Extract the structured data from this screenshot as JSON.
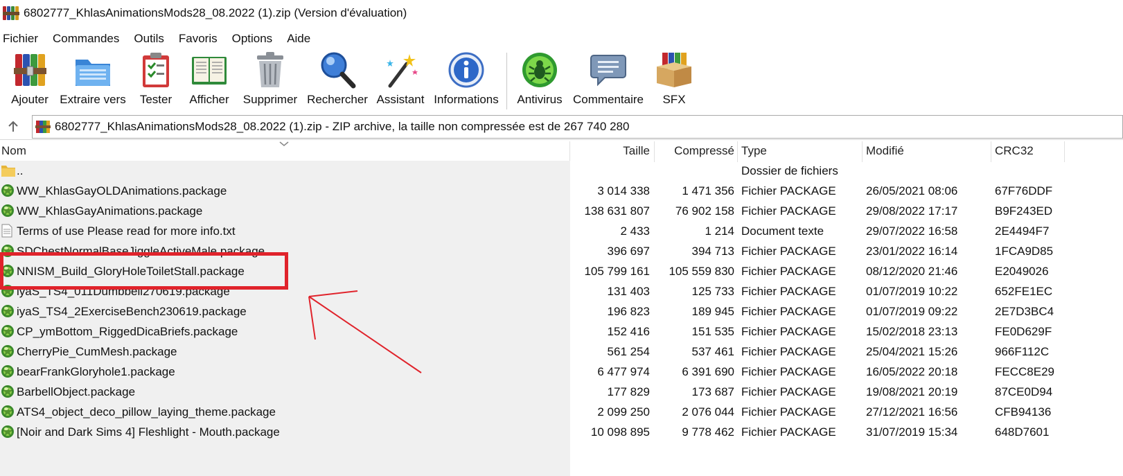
{
  "window": {
    "title": "6802777_KhlasAnimationsMods28_08.2022 (1).zip (Version d'évaluation)"
  },
  "menu": [
    "Fichier",
    "Commandes",
    "Outils",
    "Favoris",
    "Options",
    "Aide"
  ],
  "toolbar": {
    "buttons": [
      {
        "label": "Ajouter",
        "icon": "add-archive-icon"
      },
      {
        "label": "Extraire vers",
        "icon": "extract-folder-icon"
      },
      {
        "label": "Tester",
        "icon": "test-clipboard-icon"
      },
      {
        "label": "Afficher",
        "icon": "view-book-icon"
      },
      {
        "label": "Supprimer",
        "icon": "trash-icon"
      },
      {
        "label": "Rechercher",
        "icon": "magnifier-icon"
      },
      {
        "label": "Assistant",
        "icon": "wizard-wand-icon"
      },
      {
        "label": "Informations",
        "icon": "info-icon"
      },
      {
        "label": "Antivirus",
        "icon": "antivirus-bug-icon"
      },
      {
        "label": "Commentaire",
        "icon": "comment-icon"
      },
      {
        "label": "SFX",
        "icon": "sfx-box-icon"
      }
    ]
  },
  "address": {
    "text": "6802777_KhlasAnimationsMods28_08.2022 (1).zip - ZIP archive, la taille non compressée est de 267 740 280"
  },
  "columns": {
    "name": "Nom",
    "size": "Taille",
    "packed": "Compressé",
    "type": "Type",
    "modified": "Modifié",
    "crc": "CRC32"
  },
  "files": [
    {
      "name": "..",
      "size": "",
      "packed": "",
      "type": "Dossier de fichiers",
      "modified": "",
      "crc": "",
      "icon": "folder-icon"
    },
    {
      "name": "WW_KhlasGayOLDAnimations.package",
      "size": "3 014 338",
      "packed": "1 471 356",
      "type": "Fichier PACKAGE",
      "modified": "26/05/2021 08:06",
      "crc": "67F76DDF",
      "icon": "package-icon"
    },
    {
      "name": "WW_KhlasGayAnimations.package",
      "size": "138 631 807",
      "packed": "76 902 158",
      "type": "Fichier PACKAGE",
      "modified": "29/08/2022 17:17",
      "crc": "B9F243ED",
      "icon": "package-icon"
    },
    {
      "name": "Terms of use Please read for more info.txt",
      "size": "2 433",
      "packed": "1 214",
      "type": "Document texte",
      "modified": "29/07/2022 16:58",
      "crc": "2E4494F7",
      "icon": "text-file-icon"
    },
    {
      "name": "SDChestNormalBaseJiggleActiveMale.package",
      "size": "396 697",
      "packed": "394 713",
      "type": "Fichier PACKAGE",
      "modified": "23/01/2022 16:14",
      "crc": "1FCA9D85",
      "icon": "package-icon"
    },
    {
      "name": "NNISM_Build_GloryHoleToiletStall.package",
      "size": "105 799 161",
      "packed": "105 559 830",
      "type": "Fichier PACKAGE",
      "modified": "08/12/2020 21:46",
      "crc": "E2049026",
      "icon": "package-icon"
    },
    {
      "name": "iyaS_TS4_011Dumbbell270619.package",
      "size": "131 403",
      "packed": "125 733",
      "type": "Fichier PACKAGE",
      "modified": "01/07/2019 10:22",
      "crc": "652FE1EC",
      "icon": "package-icon"
    },
    {
      "name": "iyaS_TS4_2ExerciseBench230619.package",
      "size": "196 823",
      "packed": "189 945",
      "type": "Fichier PACKAGE",
      "modified": "01/07/2019 09:22",
      "crc": "2E7D3BC4",
      "icon": "package-icon"
    },
    {
      "name": "CP_ymBottom_RiggedDicaBriefs.package",
      "size": "152 416",
      "packed": "151 535",
      "type": "Fichier PACKAGE",
      "modified": "15/02/2018 23:13",
      "crc": "FE0D629F",
      "icon": "package-icon"
    },
    {
      "name": "CherryPie_CumMesh.package",
      "size": "561 254",
      "packed": "537 461",
      "type": "Fichier PACKAGE",
      "modified": "25/04/2021 15:26",
      "crc": "966F112C",
      "icon": "package-icon"
    },
    {
      "name": "bearFrankGloryhole1.package",
      "size": "6 477 974",
      "packed": "6 391 690",
      "type": "Fichier PACKAGE",
      "modified": "16/05/2022 20:18",
      "crc": "FECC8E29",
      "icon": "package-icon"
    },
    {
      "name": "BarbellObject.package",
      "size": "177 829",
      "packed": "173 687",
      "type": "Fichier PACKAGE",
      "modified": "19/08/2021 20:19",
      "crc": "87CE0D94",
      "icon": "package-icon"
    },
    {
      "name": "ATS4_object_deco_pillow_laying_theme.package",
      "size": "2 099 250",
      "packed": "2 076 044",
      "type": "Fichier PACKAGE",
      "modified": "27/12/2021 16:56",
      "crc": "CFB94136",
      "icon": "package-icon"
    },
    {
      "name": "[Noir and Dark Sims 4] Fleshlight - Mouth.package",
      "size": "10 098 895",
      "packed": "9 778 462",
      "type": "Fichier PACKAGE",
      "modified": "31/07/2019 15:34",
      "crc": "648D7601",
      "icon": "package-icon"
    }
  ],
  "annotation": {
    "color": "#e0232b"
  }
}
